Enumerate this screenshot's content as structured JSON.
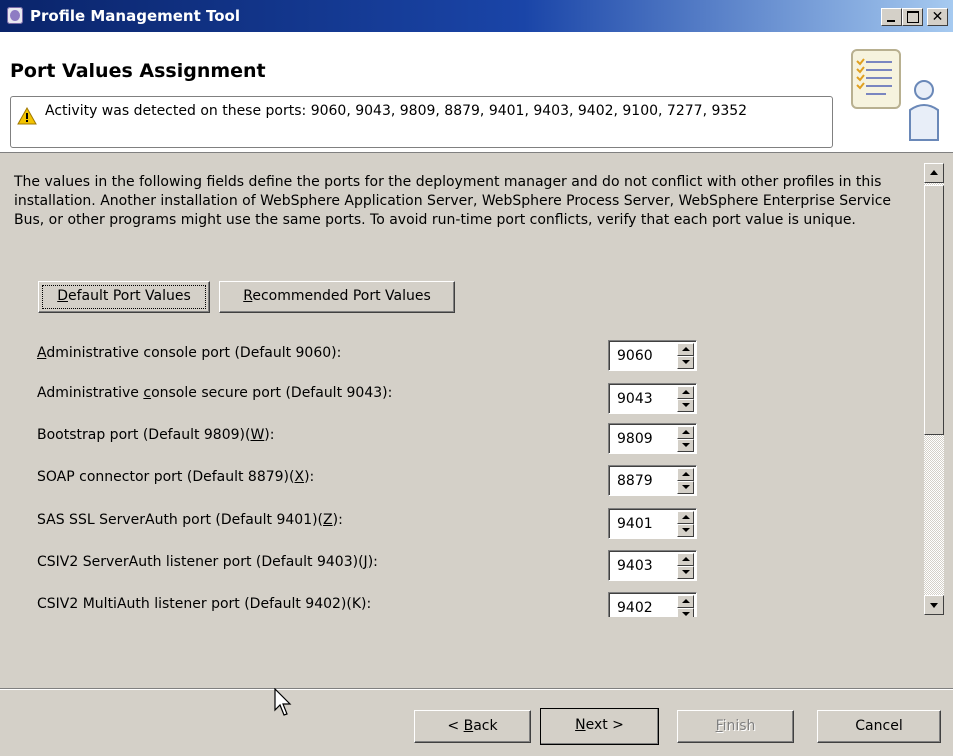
{
  "window": {
    "title": "Profile Management Tool",
    "controls": [
      "minimize",
      "maximize",
      "close"
    ]
  },
  "header": {
    "page_title": "Port Values Assignment",
    "message": "Activity was detected on these ports: 9060, 9043, 9809, 8879, 9401, 9403, 9402, 9100, 7277, 9352",
    "message_icon": "warning-icon",
    "graphic_icon": "wizard-checklist-person-icon"
  },
  "content": {
    "description": "The values in the following fields define the ports for the deployment manager and do not conflict with other profiles in this installation. Another installation of WebSphere Application Server, WebSphere Process Server, WebSphere Enterprise Service Bus, or other programs might use the same ports. To avoid run-time port conflicts, verify that each port value is unique.",
    "default_button": {
      "mnemonic": "D",
      "rest": "efault Port Values"
    },
    "recommended_button": {
      "mnemonic": "R",
      "rest": "ecommended Port Values"
    },
    "ports": [
      {
        "before": "",
        "mnemonic": "A",
        "after": "dministrative console port (Default 9060):",
        "value": "9060"
      },
      {
        "before": "Administrative ",
        "mnemonic": "c",
        "after": "onsole secure port (Default 9043):",
        "value": "9043"
      },
      {
        "before": "Bootstrap port (Default 9809)(",
        "mnemonic": "W",
        "after": "):",
        "value": "9809"
      },
      {
        "before": "SOAP connector port (Default 8879)(",
        "mnemonic": "X",
        "after": "):",
        "value": "8879"
      },
      {
        "before": "SAS SSL ServerAuth port (Default 9401)(",
        "mnemonic": "Z",
        "after": "):",
        "value": "9401"
      },
      {
        "before": "CSIV2 ServerAuth listener port (Default 9403)(",
        "mnemonic": "J",
        "after": "):",
        "value": "9403"
      },
      {
        "before": "CSIV2 MultiAuth listener port (Default 9402)(K):",
        "mnemonic": "",
        "after": "",
        "value": "9402"
      }
    ]
  },
  "footer": {
    "back": {
      "prefix": "< ",
      "mnemonic": "B",
      "rest": "ack"
    },
    "next": {
      "mnemonic": "N",
      "rest": "ext >"
    },
    "finish": {
      "mnemonic": "F",
      "rest": "inish"
    },
    "cancel": "Cancel"
  }
}
